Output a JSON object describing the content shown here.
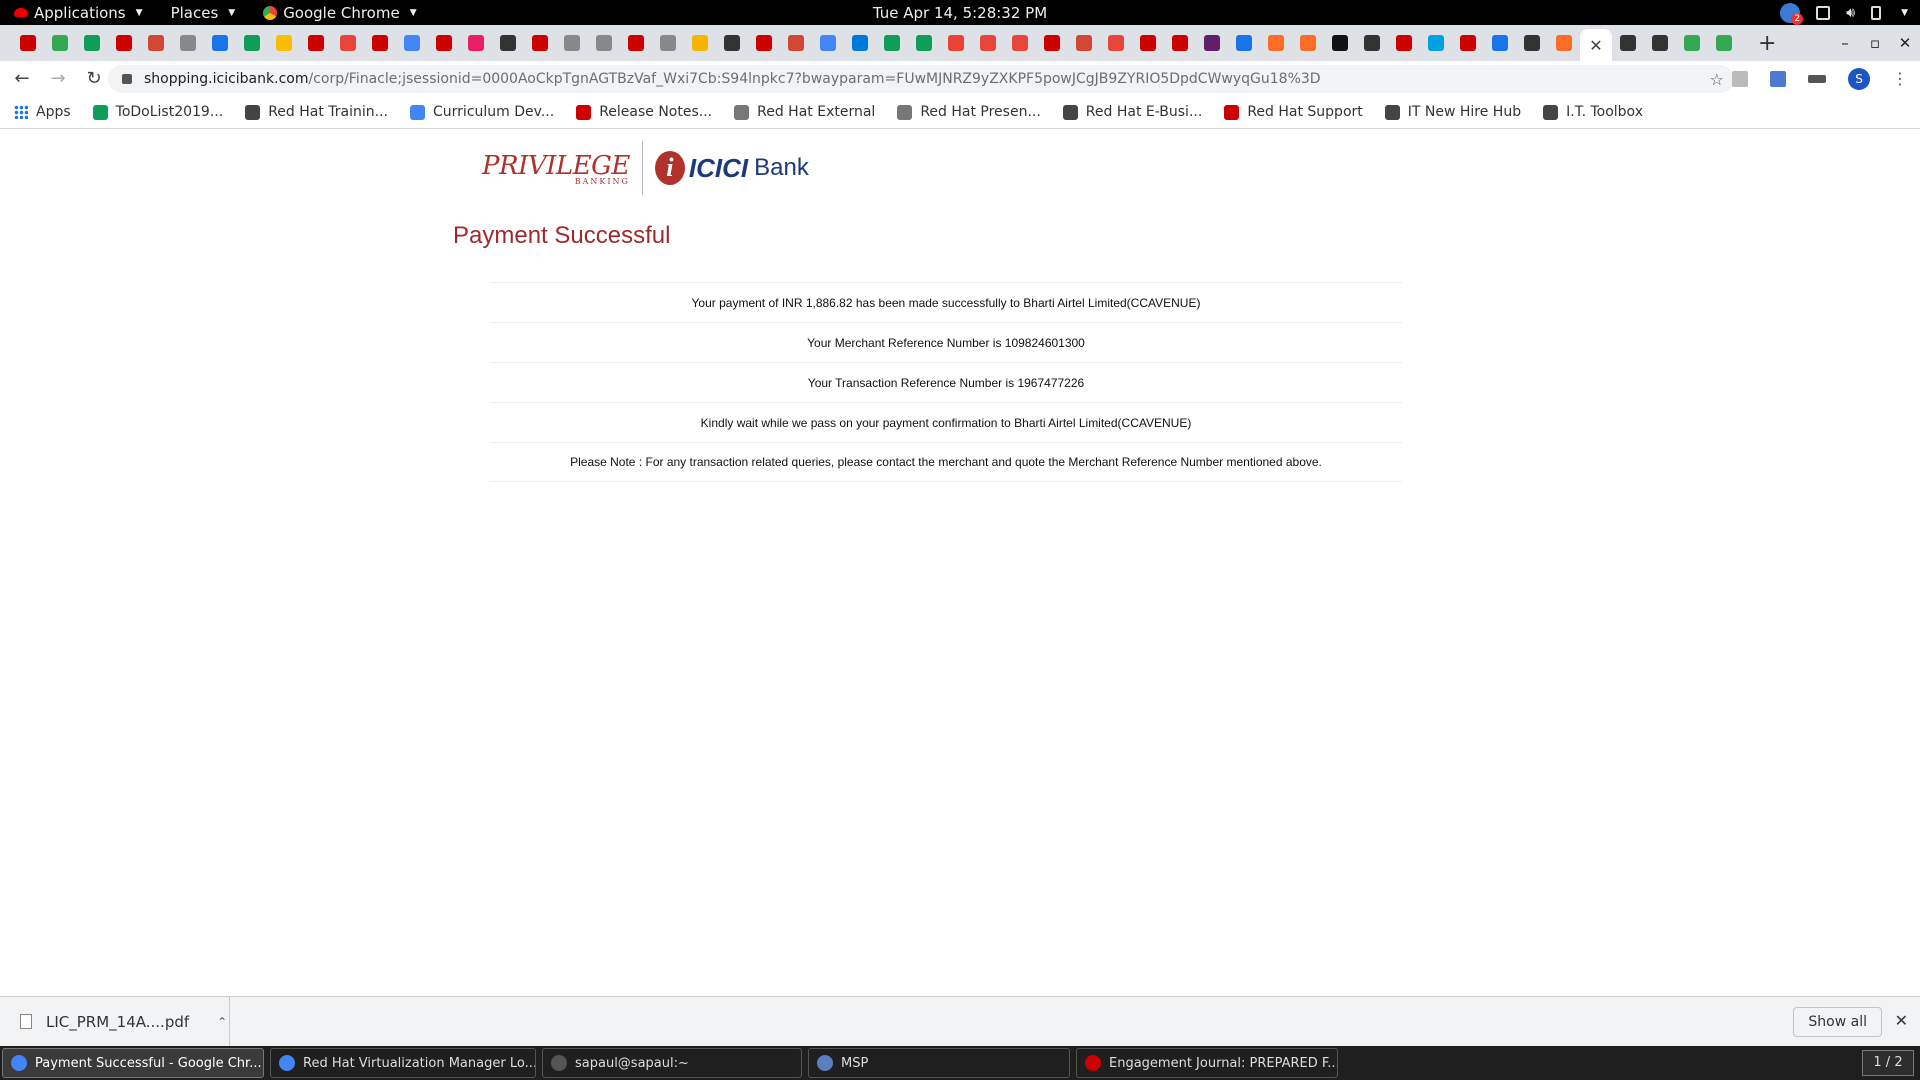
{
  "gnome_bar": {
    "applications": "Applications",
    "places": "Places",
    "active_app": "Google Chrome",
    "clock": "Tue Apr 14,  5:28:32 PM",
    "notification_count": "2"
  },
  "browser": {
    "url_host": "shopping.icicibank.com",
    "url_path": "/corp/Finacle;jsessionid=0000AoCkpTgnAGTBzVaf_Wxi7Cb:S94lnpkc7?bwayparam=FUwMJNRZ9yZXKPF5powJCgJB9ZYRIO5DpdCWwyqGu18%3D",
    "profile_initial": "S",
    "tab_favicon_colors": [
      "#cc0000",
      "#34a853",
      "#0f9d58",
      "#cc0000",
      "#d44638",
      "#888888",
      "#1a73e8",
      "#0f9d58",
      "#fbbc04",
      "#cc0000",
      "#e8453c",
      "#cc0000",
      "#4285f4",
      "#cc0000",
      "#e91e63",
      "#333333",
      "#cc0000",
      "#888888",
      "#888888",
      "#cc0000",
      "#888888",
      "#f4b400",
      "#333333",
      "#cc0000",
      "#d44638",
      "#4285f4",
      "#0078d7",
      "#0f9d58",
      "#0f9d58",
      "#ea4335",
      "#e8453c",
      "#e8453c",
      "#cc0000",
      "#d44638",
      "#e8453c",
      "#cc0000",
      "#cc0000",
      "#611f69",
      "#1a73e8",
      "#fc6d26",
      "#fc6d26",
      "#111111",
      "#333333",
      "#cc0000",
      "#00a1e0",
      "#cc0000",
      "#1a73e8",
      "#333333",
      "#fc6d26"
    ],
    "more_tab_favicon_colors": [
      "#333333",
      "#333333",
      "#34a853",
      "#34a853"
    ]
  },
  "bookmarks": [
    {
      "label": "Apps",
      "color": "#1a73e8"
    },
    {
      "label": "ToDoList2019...",
      "color": "#0f9d58"
    },
    {
      "label": "Red Hat Trainin...",
      "color": "#444444"
    },
    {
      "label": "Curriculum Dev...",
      "color": "#4285f4"
    },
    {
      "label": "Release Notes...",
      "color": "#cc0000"
    },
    {
      "label": "Red Hat External",
      "color": "#777777"
    },
    {
      "label": "Red Hat Presen...",
      "color": "#777777"
    },
    {
      "label": "Red Hat E-Busi...",
      "color": "#444444"
    },
    {
      "label": "Red Hat Support",
      "color": "#cc0000"
    },
    {
      "label": "IT New Hire Hub",
      "color": "#444444"
    },
    {
      "label": "I.T. Toolbox",
      "color": "#444444"
    }
  ],
  "page": {
    "logo_privilege": "PRIVILEGE",
    "logo_privilege_sub": "BANKING",
    "logo_icici": "ICICI",
    "logo_bank": "Bank",
    "title": "Payment Successful",
    "messages": [
      "Your payment of INR 1,886.82 has been made successfully to Bharti Airtel Limited(CCAVENUE)",
      "Your Merchant Reference Number is 109824601300",
      "Your Transaction Reference Number is 1967477226",
      "Kindly wait while we pass on your payment confirmation to Bharti Airtel Limited(CCAVENUE)",
      "Please Note : For any transaction related queries, please contact the merchant and quote the Merchant Reference Number mentioned above."
    ],
    "accent_color": "#9d2a2c"
  },
  "downloads": {
    "file_name": "LIC_PRM_14A....pdf",
    "show_all": "Show all"
  },
  "taskbar": {
    "tasks": [
      {
        "label": "Payment Successful - Google Chr...",
        "color": "#4285f4"
      },
      {
        "label": "Red Hat Virtualization Manager Lo...",
        "color": "#4285f4"
      },
      {
        "label": "sapaul@sapaul:~",
        "color": "#555555"
      },
      {
        "label": "MSP",
        "color": "#5a7fc0"
      },
      {
        "label": "Engagement Journal: PREPARED F...",
        "color": "#cc0000"
      }
    ],
    "workspace": "1 / 2"
  }
}
